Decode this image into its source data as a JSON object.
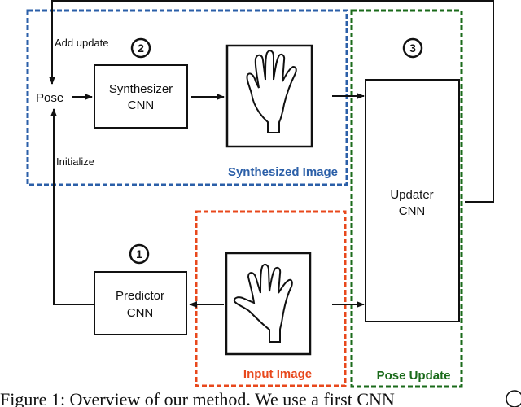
{
  "figure": {
    "groups": {
      "synthesized": {
        "label": "Synthesized Image",
        "color": "#2b5fa8"
      },
      "input": {
        "label": "Input Image",
        "color": "#e8481c"
      },
      "pose_update": {
        "label": "Pose Update",
        "color": "#1a6a1a"
      }
    },
    "nodes": {
      "pose": "Pose",
      "synthesizer": {
        "line1": "Synthesizer",
        "line2": "CNN"
      },
      "predictor": {
        "line1": "Predictor",
        "line2": "CNN"
      },
      "updater": {
        "line1": "Updater",
        "line2": "CNN"
      }
    },
    "edge_labels": {
      "add_update": "Add update",
      "initialize": "Initialize"
    },
    "step_numbers": {
      "predictor": "1",
      "synthesizer": "2",
      "updater": "3"
    },
    "caption": "Figure 1: Overview of our method. We use a first CNN"
  }
}
